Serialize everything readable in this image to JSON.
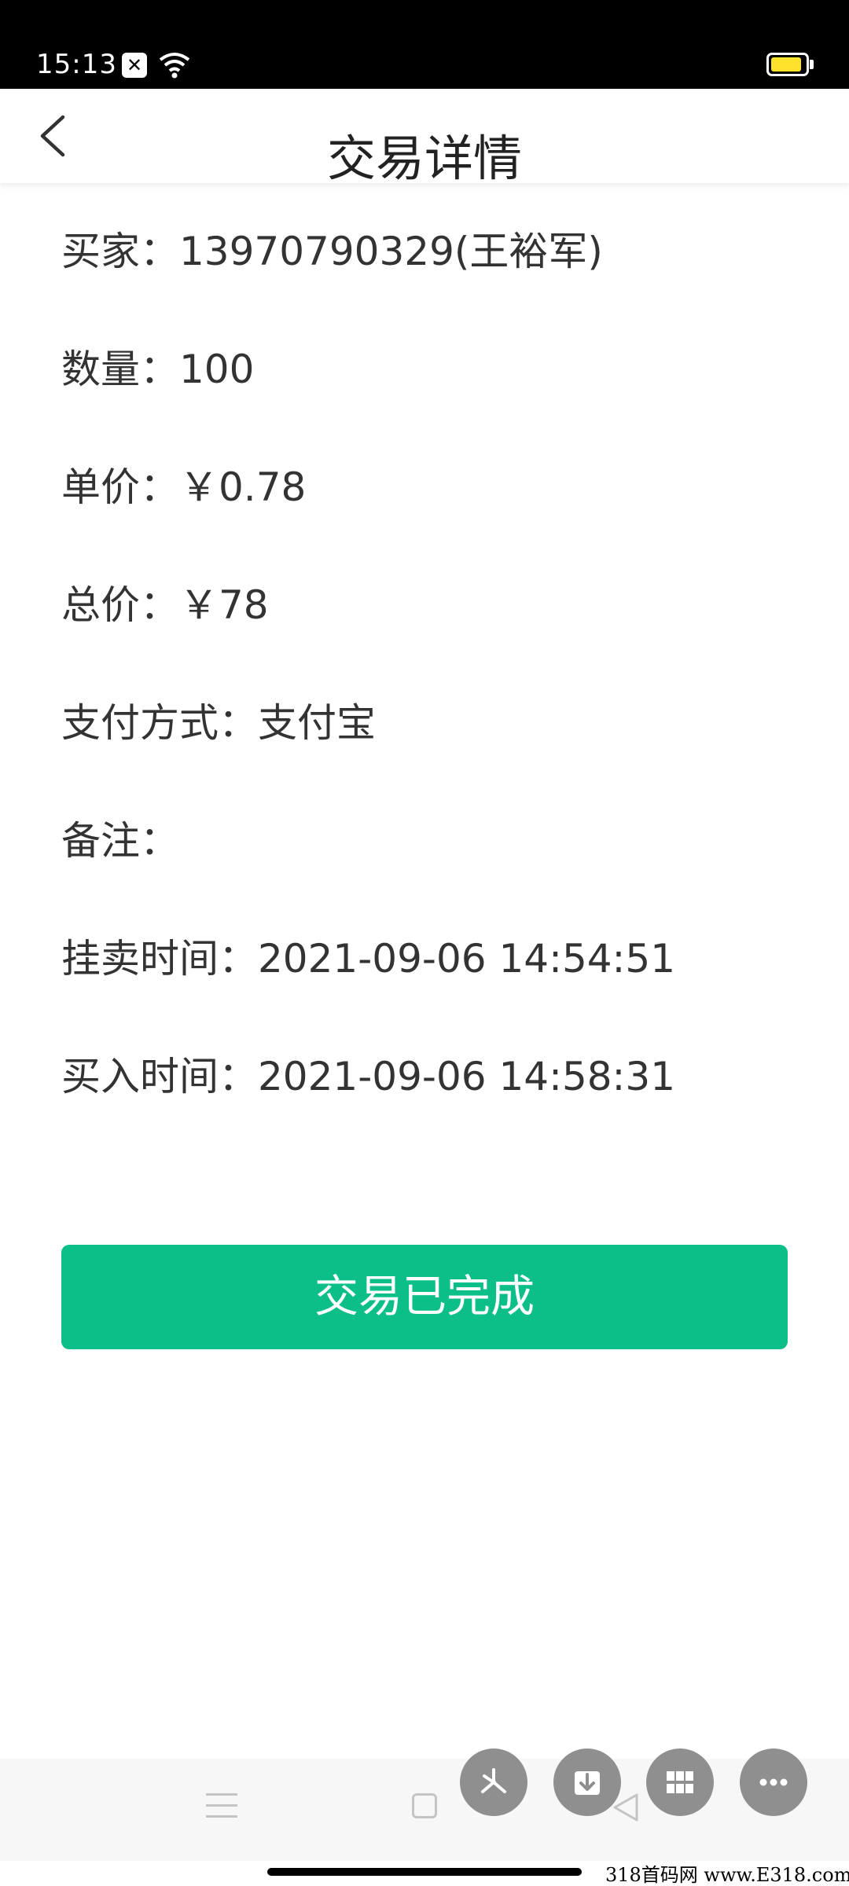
{
  "status_bar": {
    "time": "15:13",
    "battery_color": "#ffe22b"
  },
  "header": {
    "title": "交易详情",
    "back_icon": "chevron-left-icon"
  },
  "details": {
    "buyer": "买家：13970790329(王裕军)",
    "quantity": "数量：100",
    "unit_price": "单价：￥0.78",
    "total_price": "总价：￥78",
    "payment_method": "支付方式：支付宝",
    "note": "备注：",
    "listing_time": "挂卖时间：2021-09-06 14:54:51",
    "purchase_time": "买入时间：2021-09-06 14:58:31"
  },
  "action": {
    "label": "交易已完成",
    "color": "#0cbf88"
  },
  "floating_tools": [
    "pinwheel-icon",
    "download-icon",
    "grid-icon",
    "more-icon"
  ],
  "nav_bar": {
    "icons": [
      "menu-icon",
      "home-icon",
      "back-icon"
    ]
  },
  "watermark": "318首码网 www.E318.com"
}
